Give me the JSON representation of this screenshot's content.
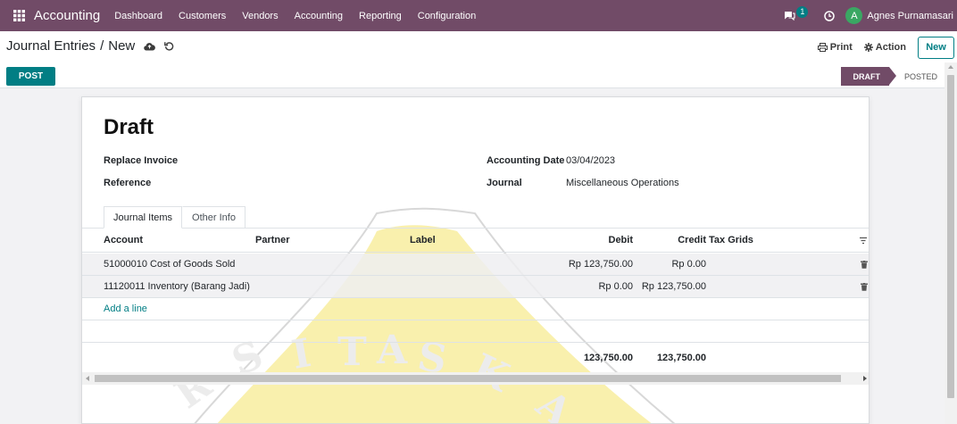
{
  "navbar": {
    "app_name": "Accounting",
    "menu": [
      "Dashboard",
      "Customers",
      "Vendors",
      "Accounting",
      "Reporting",
      "Configuration"
    ],
    "chat_badge": "1",
    "user_initial": "A",
    "user_name": "Agnes Purnamasari"
  },
  "control": {
    "breadcrumb_parent": "Journal Entries",
    "breadcrumb_sep": "/",
    "breadcrumb_current": "New",
    "print_label": "Print",
    "action_label": "Action",
    "new_label": "New",
    "post_label": "POST",
    "status": [
      "DRAFT",
      "POSTED"
    ]
  },
  "form": {
    "title": "Draft",
    "replace_invoice_label": "Replace Invoice",
    "reference_label": "Reference",
    "accounting_date_label": "Accounting Date",
    "accounting_date_value": "03/04/2023",
    "journal_label": "Journal",
    "journal_value": "Miscellaneous Operations",
    "tabs": [
      "Journal Items",
      "Other Info"
    ],
    "columns": {
      "account": "Account",
      "partner": "Partner",
      "label": "Label",
      "debit": "Debit",
      "credit": "Credit",
      "tax_grids": "Tax Grids"
    },
    "lines": [
      {
        "account": "51000010 Cost of Goods Sold",
        "partner": "",
        "label": "",
        "debit": "Rp 123,750.00",
        "credit": "Rp 0.00"
      },
      {
        "account": "11120011 Inventory (Barang Jadi)",
        "partner": "",
        "label": "",
        "debit": "Rp 0.00",
        "credit": "Rp 123,750.00"
      }
    ],
    "add_line_label": "Add a line",
    "total_debit": "123,750.00",
    "total_credit": "123,750.00"
  },
  "watermark": {
    "letters": [
      "R",
      "S",
      "I",
      "T",
      "A",
      "S",
      "K",
      "A"
    ]
  },
  "colors": {
    "brand": "#714b67",
    "accent": "#017e84",
    "watermark_fill": "#f7e98a"
  }
}
